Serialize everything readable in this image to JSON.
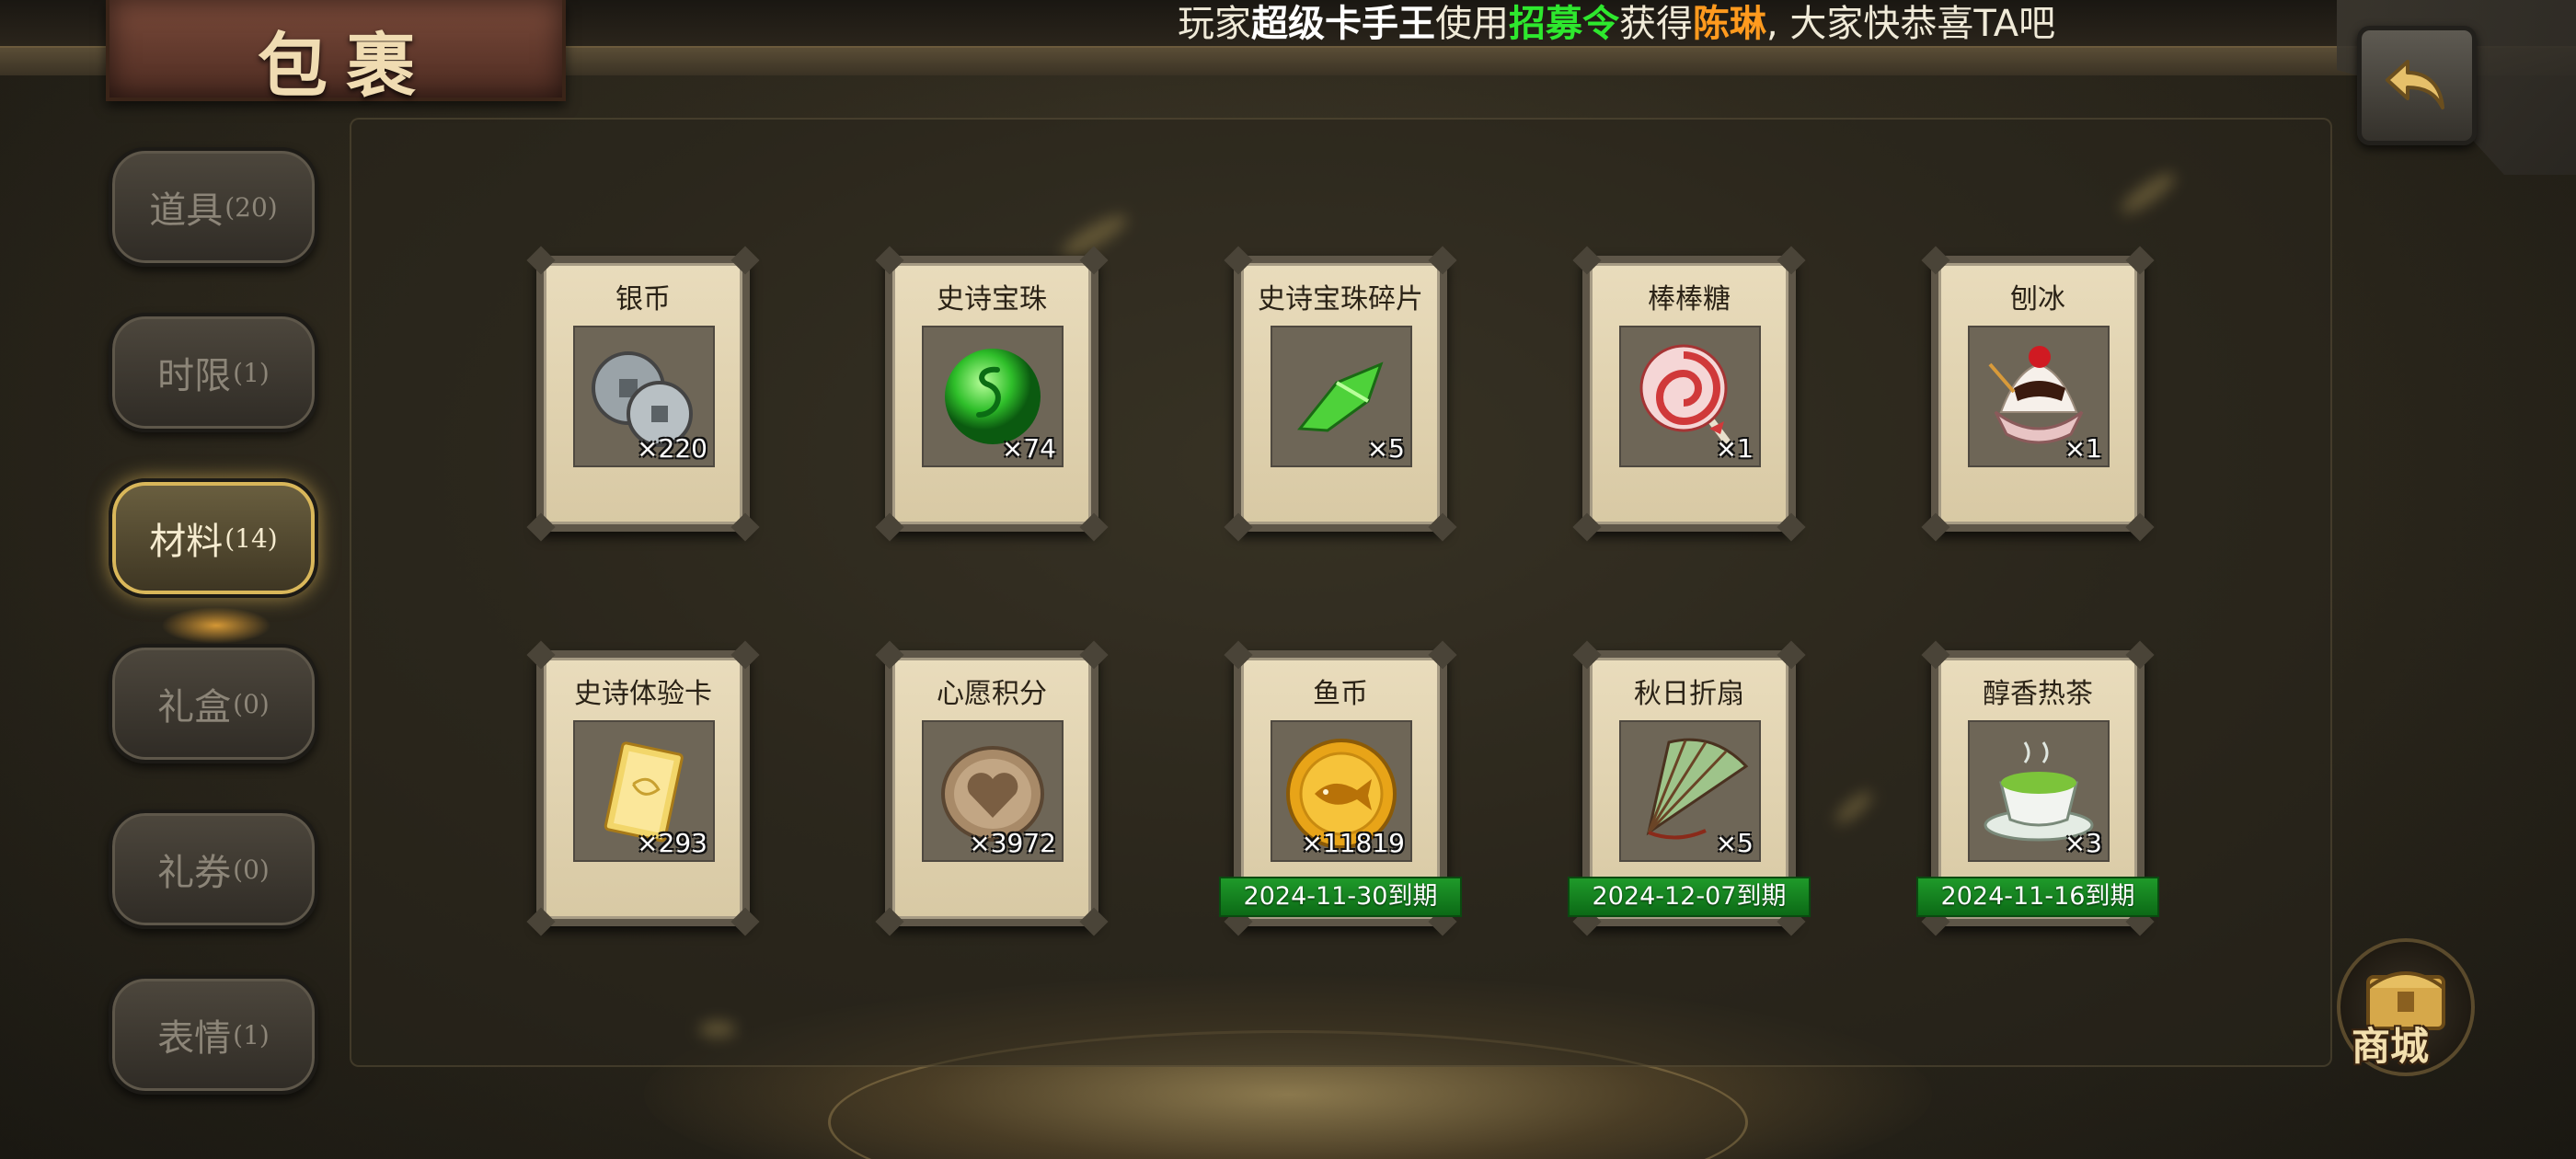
{
  "header": {
    "title": "包裹",
    "broadcast": {
      "prefix": "玩家",
      "player": "超级卡手王",
      "verb": "使用",
      "item": "招募令",
      "got": "获得",
      "reward": "陈琳",
      "suffix": ", 大家快恭喜TA吧"
    }
  },
  "colors": {
    "highlight_green": "#2ee82e",
    "highlight_orange": "#ff9a1e",
    "expiry_green": "#1f9a2a",
    "active_tab_gold": "#d9b75a"
  },
  "tabs": [
    {
      "label": "道具",
      "count": "(20)",
      "active": false
    },
    {
      "label": "时限",
      "count": "(1)",
      "active": false
    },
    {
      "label": "材料",
      "count": "(14)",
      "active": true
    },
    {
      "label": "礼盒",
      "count": "(0)",
      "active": false
    },
    {
      "label": "礼券",
      "count": "(0)",
      "active": false
    },
    {
      "label": "表情",
      "count": "(1)",
      "active": false
    }
  ],
  "items": [
    {
      "name": "银币",
      "qty": "×220",
      "icon": "silver-coin-icon"
    },
    {
      "name": "史诗宝珠",
      "qty": "×74",
      "icon": "epic-orb-icon"
    },
    {
      "name": "史诗宝珠碎片",
      "qty": "×5",
      "icon": "orb-shard-icon"
    },
    {
      "name": "棒棒糖",
      "qty": "×1",
      "icon": "lollipop-icon"
    },
    {
      "name": "刨冰",
      "qty": "×1",
      "icon": "shaved-ice-icon"
    },
    {
      "name": "史诗体验卡",
      "qty": "×293",
      "icon": "experience-card-icon"
    },
    {
      "name": "心愿积分",
      "qty": "×3972",
      "icon": "heart-coin-icon"
    },
    {
      "name": "鱼币",
      "qty": "×11819",
      "icon": "fish-coin-icon",
      "expiry": "2024-11-30到期"
    },
    {
      "name": "秋日折扇",
      "qty": "×5",
      "icon": "folding-fan-icon",
      "expiry": "2024-12-07到期"
    },
    {
      "name": "醇香热茶",
      "qty": "×3",
      "icon": "hot-tea-icon",
      "expiry": "2024-11-16到期"
    }
  ],
  "shop": {
    "label": "商城"
  },
  "back": {
    "icon": "back-arrow-icon"
  }
}
